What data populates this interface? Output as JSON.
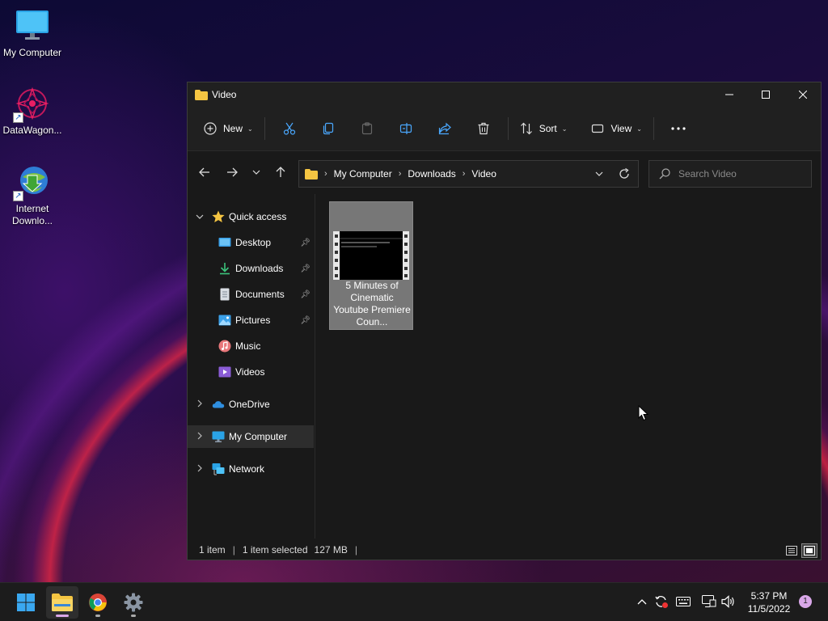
{
  "desktop": {
    "icons": [
      {
        "label": "My Computer"
      },
      {
        "label": "DataWagon..."
      },
      {
        "label": "Internet Downlo..."
      }
    ]
  },
  "window": {
    "title": "Video",
    "toolbar": {
      "new_label": "New",
      "sort_label": "Sort",
      "view_label": "View"
    },
    "address": {
      "crumbs": [
        "My Computer",
        "Downloads",
        "Video"
      ]
    },
    "search": {
      "placeholder": "Search Video"
    },
    "nav": {
      "quick_access": "Quick access",
      "items": [
        {
          "label": "Desktop"
        },
        {
          "label": "Downloads"
        },
        {
          "label": "Documents"
        },
        {
          "label": "Pictures"
        },
        {
          "label": "Music"
        },
        {
          "label": "Videos"
        }
      ],
      "onedrive": "OneDrive",
      "my_computer": "My Computer",
      "network": "Network"
    },
    "files": [
      {
        "name": "5 Minutes of Cinematic Youtube Premiere Coun..."
      }
    ],
    "status": {
      "count": "1 item",
      "selected": "1 item selected",
      "size": "127 MB"
    }
  },
  "taskbar": {
    "time": "5:37 PM",
    "date": "11/5/2022",
    "notifications": "1"
  },
  "colors": {
    "accent": "#0078d4",
    "folder": "#f5c542",
    "window_bg": "#191919"
  }
}
